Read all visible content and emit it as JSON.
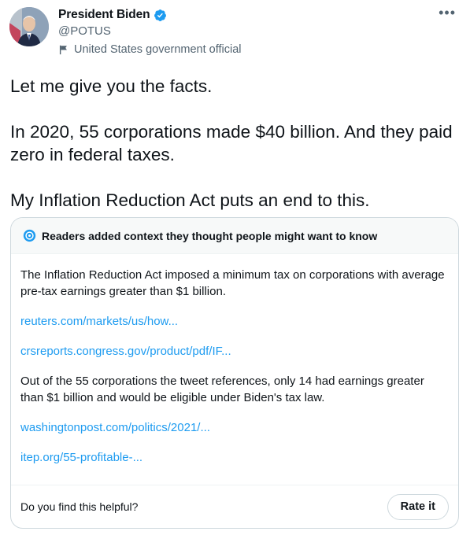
{
  "author": {
    "display_name": "President Biden",
    "handle": "@POTUS",
    "label": "United States government official",
    "verified": true,
    "avatar_icon": "avatar-portrait",
    "verified_icon": "verified-badge-icon",
    "accent_color": "#1d9bf0"
  },
  "tweet": {
    "paragraphs": [
      "Let me give you the facts.",
      "In 2020, 55 corporations made $40 billion. And they paid zero in federal taxes.",
      "My Inflation Reduction Act puts an end to this."
    ]
  },
  "community_note": {
    "header": "Readers added context they thought people might want to know",
    "header_icon": "community-notes-icon",
    "items": [
      {
        "type": "text",
        "value": "The Inflation Reduction Act imposed a minimum tax on corporations with average pre-tax earnings greater than $1 billion."
      },
      {
        "type": "link",
        "value": "reuters.com/markets/us/how..."
      },
      {
        "type": "link",
        "value": "crsreports.congress.gov/product/pdf/IF..."
      },
      {
        "type": "text",
        "value": "Out of the 55 corporations the tweet references, only 14 had earnings greater than $1 billion and would be eligible under Biden's tax law."
      },
      {
        "type": "link",
        "value": "washingtonpost.com/politics/2021/..."
      },
      {
        "type": "link",
        "value": "itep.org/55-profitable-..."
      }
    ],
    "footer_question": "Do you find this helpful?",
    "rate_button": "Rate it"
  },
  "more_menu": "•••"
}
